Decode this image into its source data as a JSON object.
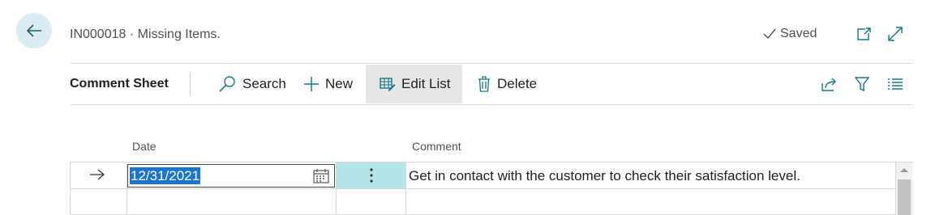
{
  "header": {
    "title": "IN000018 · Missing Items.",
    "saved_label": "Saved",
    "icons": [
      "back-arrow-icon",
      "checkmark-icon",
      "open-in-new-window-icon",
      "expand-icon"
    ]
  },
  "command_bar": {
    "title": "Comment Sheet",
    "search_label": "Search",
    "new_label": "New",
    "edit_list_label": "Edit List",
    "delete_label": "Delete",
    "right_icons": [
      "share-icon",
      "filter-icon",
      "list-view-icon"
    ]
  },
  "table": {
    "columns": [
      "Date",
      "Comment"
    ],
    "rows": [
      {
        "date": "12/31/2021",
        "comment": "Get in contact with the customer to check their satisfaction level.",
        "selected": true
      },
      {
        "date": "",
        "comment": "",
        "selected": false
      }
    ]
  },
  "colors": {
    "accent": "#1c75d1",
    "back_button_bg": "#d8ecf1",
    "selected_cell_bg": "#b3e4ea",
    "active_button_bg": "#e6e6e6",
    "icon_teal": "#0f7a8a"
  }
}
